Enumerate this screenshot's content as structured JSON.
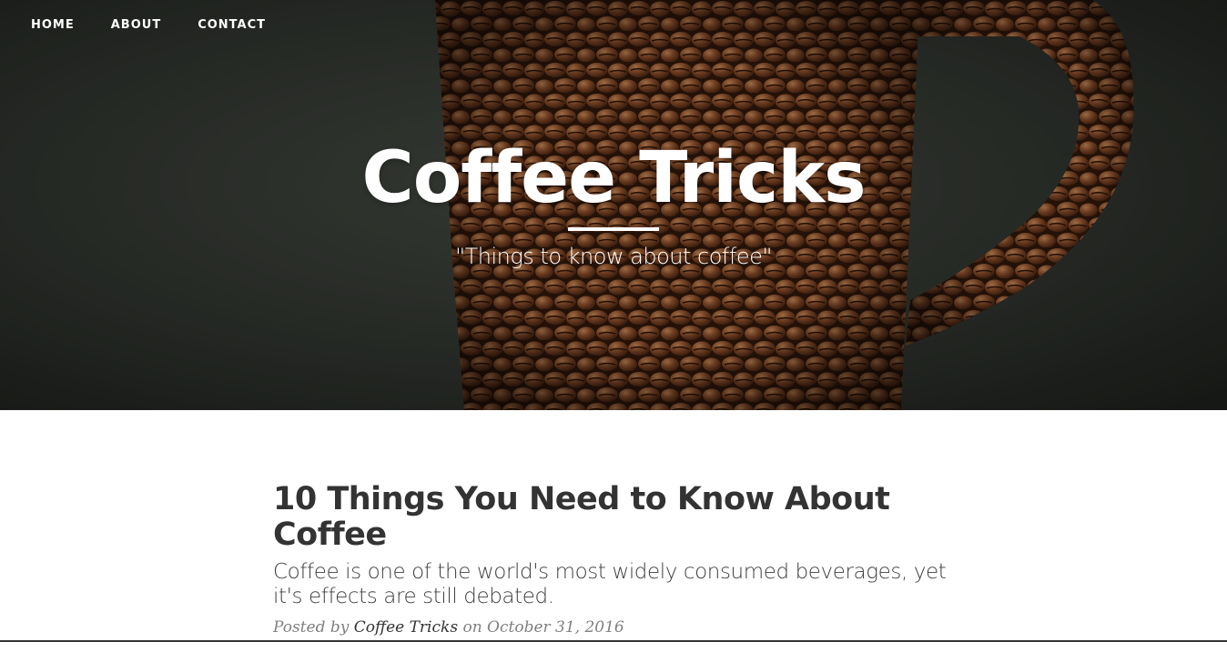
{
  "nav": {
    "items": [
      "HOME",
      "ABOUT",
      "CONTACT"
    ]
  },
  "hero": {
    "title": "Coffee Tricks",
    "tagline": "\"Things to know about coffee\"",
    "image": "coffee-bean-mug-photo"
  },
  "post": {
    "title": "10 Things You Need to Know About Coffee",
    "subtitle": "Coffee is one of the world's most widely consumed beverages, yet it's effects are still debated.",
    "meta_prefix": "Posted by",
    "author": "Coffee Tricks",
    "meta_on": "on",
    "date": "October 31, 2016"
  },
  "colors": {
    "hero_background": "#2a2e29",
    "bean_brown": "#6b3a1f",
    "text_dark": "#333333",
    "text_muted": "#808080"
  }
}
